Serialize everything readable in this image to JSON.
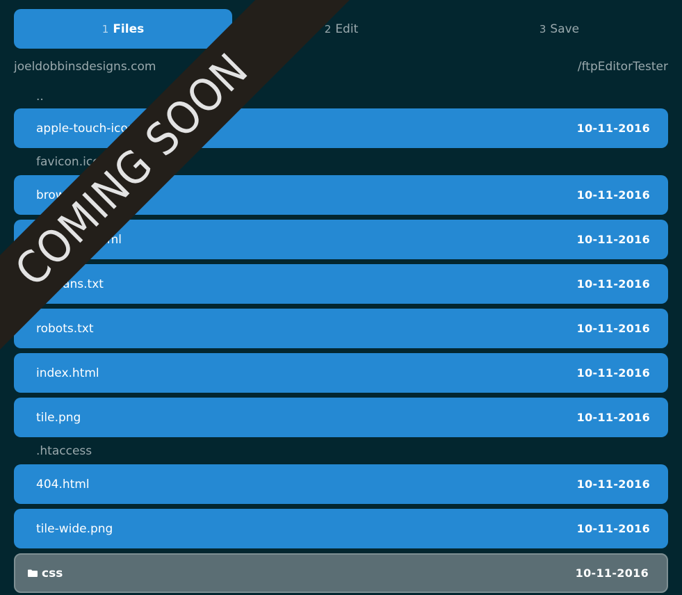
{
  "steps": [
    {
      "num": "1",
      "label": "Files"
    },
    {
      "num": "2",
      "label": "Edit"
    },
    {
      "num": "3",
      "label": "Save"
    }
  ],
  "path": {
    "host": "joeldobbinsdesigns.com",
    "dir": "/ftpEditorTester"
  },
  "files": [
    {
      "name": "..",
      "date": ""
    },
    {
      "name": "apple-touch-icon.png",
      "date": "10-11-2016"
    },
    {
      "name": "favicon.ico",
      "date": ""
    },
    {
      "name": "browserconfig.xml",
      "date": "10-11-2016"
    },
    {
      "name": "index-old.html",
      "date": "10-11-2016"
    },
    {
      "name": "humans.txt",
      "date": "10-11-2016"
    },
    {
      "name": "robots.txt",
      "date": "10-11-2016"
    },
    {
      "name": "index.html",
      "date": "10-11-2016"
    },
    {
      "name": "tile.png",
      "date": "10-11-2016"
    },
    {
      "name": ".htaccess",
      "date": ""
    },
    {
      "name": "404.html",
      "date": "10-11-2016"
    },
    {
      "name": "tile-wide.png",
      "date": "10-11-2016"
    },
    {
      "name": "css",
      "date": "10-11-2016",
      "icon": "folder-icon"
    }
  ],
  "ribbon": {
    "text": "COMING SOON"
  },
  "colors": {
    "accent": "#2589d3",
    "background": "#03262f",
    "folder": "#5b6e74",
    "ribbon": "#231f1a"
  }
}
